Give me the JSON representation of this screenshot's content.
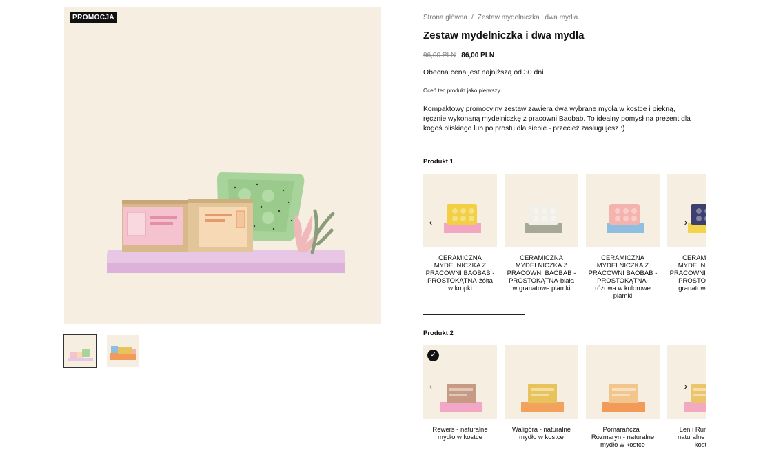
{
  "gallery": {
    "badge": "PROMOCJA",
    "progress_hint": "main image",
    "thumbnails": [
      "thumbnail-1",
      "thumbnail-2"
    ]
  },
  "breadcrumb": {
    "home": "Strona główna",
    "separator": "/",
    "current": "Zestaw mydelniczka i dwa mydła"
  },
  "product": {
    "title": "Zestaw mydelniczka i dwa mydła",
    "price_old": "96,00 PLN",
    "price_new": "86,00 PLN",
    "lowest_price_note": "Obecna cena jest najniższą od 30 dni.",
    "rate_link": "Oceń ten produkt jako pierwszy",
    "description": "Kompaktowy promocyjny zestaw zawiera dwa wybrane mydła w kostce i piękną, ręcznie wykonaną mydelniczkę z pracowni Baobab. To idealny pomysł na prezent dla kogoś bliskiego lub po prostu dla siebie - przecież zasługujesz :)"
  },
  "product1": {
    "label": "Produkt 1",
    "scroll_progress": 0.36,
    "items": [
      {
        "title": "CERAMICZNA MYDELNICZKA Z PRACOWNI BAOBAB - PROSTOKĄTNA-żółta w kropki",
        "dish": "#f2cf43",
        "base": "#f2a6c4"
      },
      {
        "title": "CERAMICZNA MYDELNICZKA Z PRACOWNI BAOBAB - PROSTOKĄTNA-biała w granatowe plamki",
        "dish": "#f2efe7",
        "base": "#a6a898"
      },
      {
        "title": "CERAMICZNA MYDELNICZKA Z PRACOWNI BAOBAB - PROSTOKĄTNA-różowa w kolorowe plamki",
        "dish": "#f4b3ad",
        "base": "#8fbfe0"
      },
      {
        "title": "CERAMICZNA MYDELNICZKA Z PRACOWNI BAOBAB - PROSTOKĄTNA-granatowe plamki",
        "dish": "#3d3f6e",
        "base": "#f2d54a"
      }
    ]
  },
  "product2": {
    "label": "Produkt 2",
    "items": [
      {
        "title": "Rewers - naturalne mydło w kostce",
        "soap": "#c79a84",
        "base": "#f2a7c7",
        "selected": true
      },
      {
        "title": "Waligóra - naturalne mydło w kostce",
        "soap": "#e8c25a",
        "base": "#f3a25e",
        "selected": false
      },
      {
        "title": "Pomarańcza i Rozmaryn - naturalne mydło w kostce",
        "soap": "#f1c58b",
        "base": "#f29b58",
        "selected": false
      },
      {
        "title": "Len i Rumianek - naturalne mydło w kostce",
        "soap": "#ecc46a",
        "base": "#f4a9c2",
        "selected": false
      }
    ]
  },
  "icons": {
    "prev": "‹",
    "next": "›",
    "check": "✓"
  },
  "colors": {
    "cream": "#f6efe1",
    "accent": "#111111"
  }
}
